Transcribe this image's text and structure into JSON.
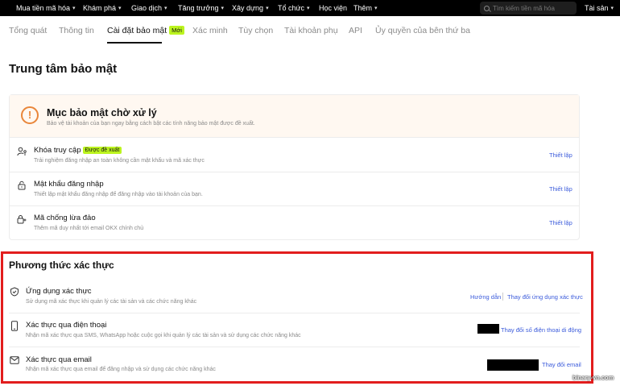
{
  "nav": {
    "items": [
      {
        "label": "Mua tiền mã hóa",
        "chevron": true
      },
      {
        "label": "Khám phá",
        "chevron": true
      },
      {
        "label": "Giao dịch",
        "chevron": true
      },
      {
        "label": "Tăng trưởng",
        "chevron": true
      },
      {
        "label": "Xây dựng",
        "chevron": true
      },
      {
        "label": "Tổ chức",
        "chevron": true
      },
      {
        "label": "Học viện",
        "chevron": false
      },
      {
        "label": "Thêm",
        "chevron": true
      }
    ],
    "search_placeholder": "Tìm kiếm tiền mã hóa",
    "assets_label": "Tài sản",
    "assets_chevron": "▾"
  },
  "tabs": [
    {
      "label": "Tổng quát",
      "active": false
    },
    {
      "label": "Thông tin",
      "active": false
    },
    {
      "label": "Cài đặt bảo mật",
      "active": true,
      "badge": "Mới"
    },
    {
      "label": "Xác minh",
      "active": false
    },
    {
      "label": "Tùy chọn",
      "active": false
    },
    {
      "label": "Tài khoản phụ",
      "active": false
    },
    {
      "label": "API",
      "active": false
    },
    {
      "label": "Ủy quyền của bên thứ ba",
      "active": false
    }
  ],
  "page_title": "Trung tâm bảo mật",
  "pending": {
    "icon": "!",
    "title": "Mục bảo mật chờ xử lý",
    "subtitle": "Bảo vệ tài khoản của bạn ngay bằng cách bật các tính năng bảo mật được đề xuất.",
    "rows": [
      {
        "title": "Khóa truy cập",
        "badge": "Được đề xuất",
        "desc": "Trải nghiệm đăng nhập an toàn không cần mật khẩu và mã xác thực",
        "action": "Thiết lập",
        "icon": "passkey-icon"
      },
      {
        "title": "Mật khẩu đăng nhập",
        "desc": "Thiết lập mật khẩu đăng nhập để đăng nhập vào tài khoản của bạn.",
        "action": "Thiết lập",
        "icon": "lock-icon"
      },
      {
        "title": "Mã chống lừa đảo",
        "desc": "Thêm mã duy nhất tới email OKX chính chủ",
        "action": "Thiết lập",
        "icon": "anti-phishing-icon"
      }
    ]
  },
  "auth": {
    "title": "Phương thức xác thực",
    "rows": [
      {
        "title": "Ứng dụng xác thực",
        "desc": "Sử dụng mã xác thực khi quản lý các tài sản và các chức năng khác",
        "actions": [
          "Hướng dẫn",
          "Thay đổi ứng dụng xác thực"
        ],
        "icon": "authenticator-icon"
      },
      {
        "title": "Xác thực qua điện thoại",
        "desc": "Nhận mã xác thực qua SMS, WhatsApp hoặc cuộc gọi khi quản lý các tài sản và sử dụng các chức năng khác",
        "actions": [
          "Thay đổi số điện thoại di động"
        ],
        "icon": "phone-icon"
      },
      {
        "title": "Xác thực qua email",
        "desc": "Nhận mã xác thực qua email để đăng nhập và sử dụng các chức năng khác",
        "actions": [
          "Thay đổi email"
        ],
        "icon": "mail-icon"
      }
    ]
  },
  "watermark": "binary-vn.com",
  "colors": {
    "accent": "#bcf41f",
    "link": "#3b5bdb",
    "warning": "#e9863a",
    "highlight_box": "#e21d1d"
  }
}
